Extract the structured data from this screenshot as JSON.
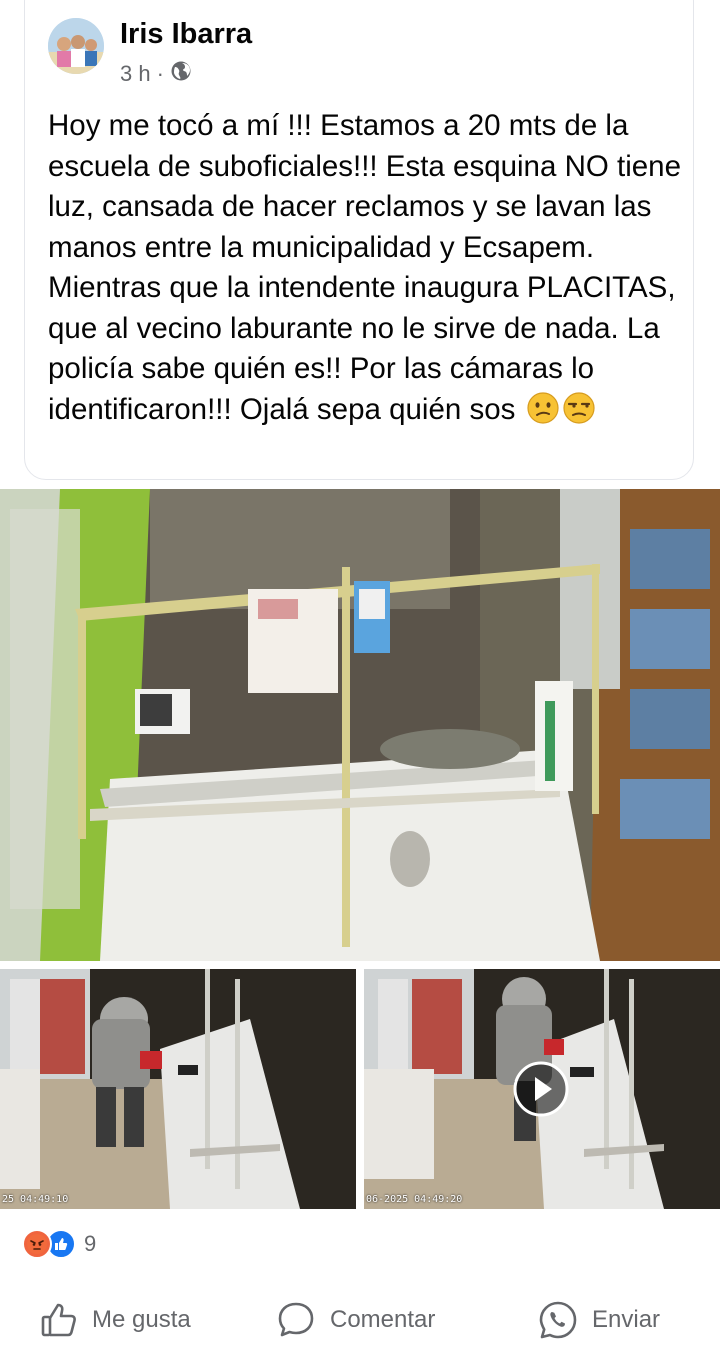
{
  "post": {
    "author": "Iris Ibarra",
    "time": "3 h",
    "separator": "·",
    "audience_icon": "globe-icon",
    "text": "Hoy me tocó a mí !!! Estamos a 20 mts de la escuela de suboficiales!!! Esta esquina NO tiene luz, cansada de hacer reclamos y se lavan las manos entre la municipalidad y Ecsapem. Mientras que la intendente inaugura PLACITAS, que al vecino laburante no le sirve de nada. La policía sabe quién es!! Por las cámaras lo identificaron!!! Ojalá sepa quién sos",
    "emojis": [
      "confused-face-emoji",
      "unamused-face-emoji"
    ]
  },
  "media": {
    "main_mute_icon": "speaker-muted-icon",
    "thumb_left_timestamp": "25 04:49:10",
    "thumb_right_timestamp": "06-2025 04:49:20",
    "thumb_right_play_icon": "play-icon"
  },
  "reactions": {
    "icons": [
      "angry-reaction-icon",
      "like-reaction-icon"
    ],
    "count": "9"
  },
  "actions": {
    "like_label": "Me gusta",
    "comment_label": "Comentar",
    "send_label": "Enviar"
  },
  "colors": {
    "secondary_text": "#65676b",
    "like_blue": "#1877f2",
    "angry_orange": "#f0643e"
  }
}
